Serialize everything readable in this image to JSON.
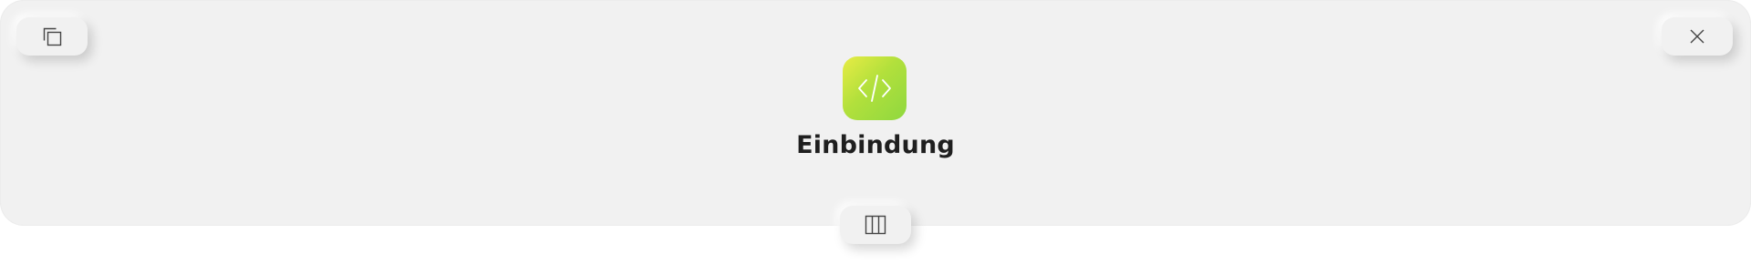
{
  "window": {
    "title": "Einbindung"
  },
  "icons": {
    "app": "code-icon",
    "copy": "copy-icon",
    "close": "close-icon",
    "columns": "columns-icon"
  },
  "colors": {
    "panel_background": "#f1f1f1",
    "app_icon_gradient_start": "#e8ec45",
    "app_icon_gradient_end": "#8fd83f",
    "title_text": "#1f1f1f"
  }
}
